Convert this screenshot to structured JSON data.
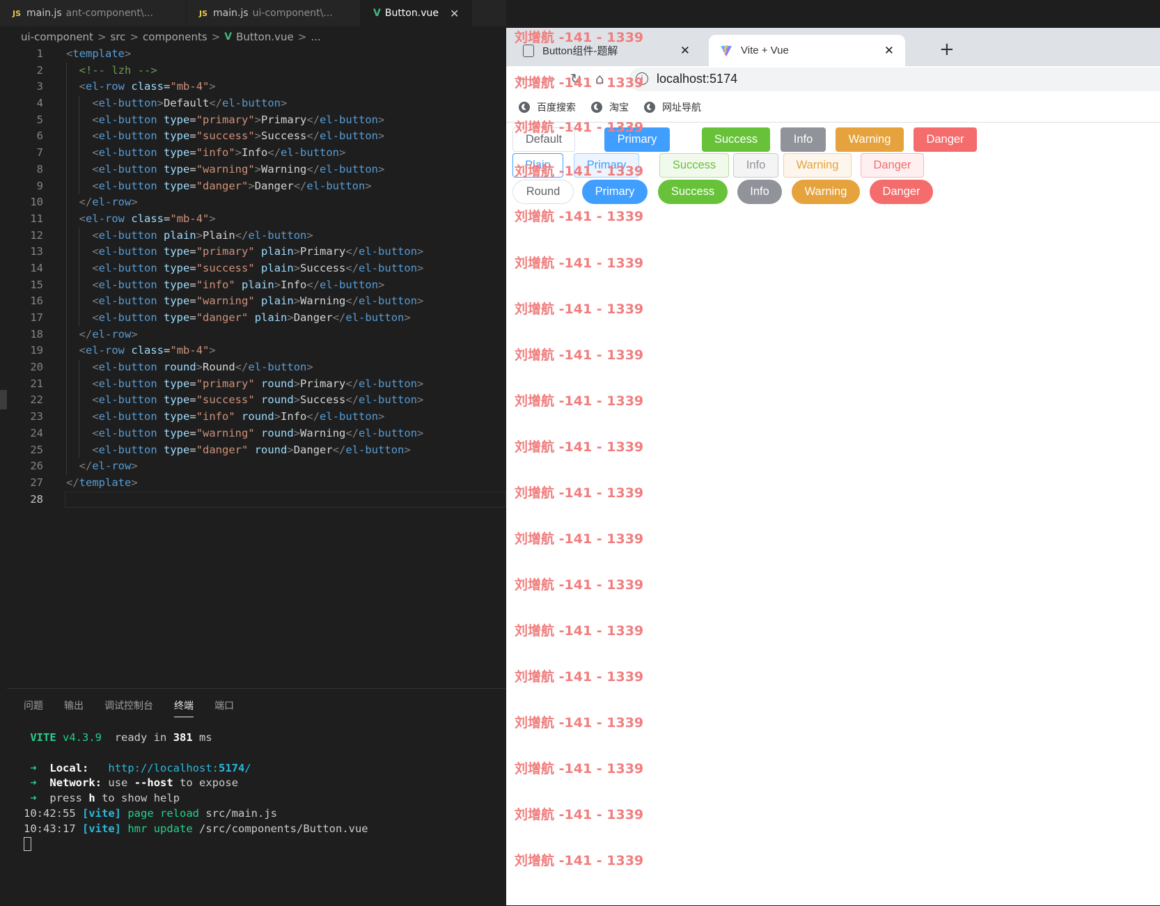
{
  "editor": {
    "tabs": [
      {
        "icon": "JS",
        "name": "main.js",
        "dir": "ant-component\\..."
      },
      {
        "icon": "JS",
        "name": "main.js",
        "dir": "ui-component\\..."
      },
      {
        "icon": "V",
        "name": "Button.vue",
        "close": "✕"
      }
    ],
    "breadcrumb": [
      "ui-component",
      "src",
      "components",
      "Button.vue",
      "..."
    ],
    "breadcrumb_sep": ">",
    "line_numbers": [
      "1",
      "2",
      "3",
      "4",
      "5",
      "6",
      "7",
      "8",
      "9",
      "10",
      "11",
      "12",
      "13",
      "14",
      "15",
      "16",
      "17",
      "18",
      "19",
      "20",
      "21",
      "22",
      "23",
      "24",
      "25",
      "26",
      "27",
      "28"
    ],
    "code_lines": [
      [
        [
          "br",
          "<"
        ],
        [
          "tag",
          "template"
        ],
        [
          "br",
          ">"
        ]
      ],
      [
        [
          "tx",
          "  "
        ],
        [
          "cm",
          "<!-- lzh -->"
        ]
      ],
      [
        [
          "tx",
          "  "
        ],
        [
          "br",
          "<"
        ],
        [
          "tag",
          "el-row"
        ],
        [
          "tx",
          " "
        ],
        [
          "at",
          "class"
        ],
        [
          "tx",
          "="
        ],
        [
          "st",
          "\"mb-4\""
        ],
        [
          "br",
          ">"
        ]
      ],
      [
        [
          "tx",
          "    "
        ],
        [
          "br",
          "<"
        ],
        [
          "tag",
          "el-button"
        ],
        [
          "br",
          ">"
        ],
        [
          "tx",
          "Default"
        ],
        [
          "br",
          "</"
        ],
        [
          "tag",
          "el-button"
        ],
        [
          "br",
          ">"
        ]
      ],
      [
        [
          "tx",
          "    "
        ],
        [
          "br",
          "<"
        ],
        [
          "tag",
          "el-button"
        ],
        [
          "tx",
          " "
        ],
        [
          "at",
          "type"
        ],
        [
          "tx",
          "="
        ],
        [
          "st",
          "\"primary\""
        ],
        [
          "br",
          ">"
        ],
        [
          "tx",
          "Primary"
        ],
        [
          "br",
          "</"
        ],
        [
          "tag",
          "el-button"
        ],
        [
          "br",
          ">"
        ]
      ],
      [
        [
          "tx",
          "    "
        ],
        [
          "br",
          "<"
        ],
        [
          "tag",
          "el-button"
        ],
        [
          "tx",
          " "
        ],
        [
          "at",
          "type"
        ],
        [
          "tx",
          "="
        ],
        [
          "st",
          "\"success\""
        ],
        [
          "br",
          ">"
        ],
        [
          "tx",
          "Success"
        ],
        [
          "br",
          "</"
        ],
        [
          "tag",
          "el-button"
        ],
        [
          "br",
          ">"
        ]
      ],
      [
        [
          "tx",
          "    "
        ],
        [
          "br",
          "<"
        ],
        [
          "tag",
          "el-button"
        ],
        [
          "tx",
          " "
        ],
        [
          "at",
          "type"
        ],
        [
          "tx",
          "="
        ],
        [
          "st",
          "\"info\""
        ],
        [
          "br",
          ">"
        ],
        [
          "tx",
          "Info"
        ],
        [
          "br",
          "</"
        ],
        [
          "tag",
          "el-button"
        ],
        [
          "br",
          ">"
        ]
      ],
      [
        [
          "tx",
          "    "
        ],
        [
          "br",
          "<"
        ],
        [
          "tag",
          "el-button"
        ],
        [
          "tx",
          " "
        ],
        [
          "at",
          "type"
        ],
        [
          "tx",
          "="
        ],
        [
          "st",
          "\"warning\""
        ],
        [
          "br",
          ">"
        ],
        [
          "tx",
          "Warning"
        ],
        [
          "br",
          "</"
        ],
        [
          "tag",
          "el-button"
        ],
        [
          "br",
          ">"
        ]
      ],
      [
        [
          "tx",
          "    "
        ],
        [
          "br",
          "<"
        ],
        [
          "tag",
          "el-button"
        ],
        [
          "tx",
          " "
        ],
        [
          "at",
          "type"
        ],
        [
          "tx",
          "="
        ],
        [
          "st",
          "\"danger\""
        ],
        [
          "br",
          ">"
        ],
        [
          "tx",
          "Danger"
        ],
        [
          "br",
          "</"
        ],
        [
          "tag",
          "el-button"
        ],
        [
          "br",
          ">"
        ]
      ],
      [
        [
          "tx",
          "  "
        ],
        [
          "br",
          "</"
        ],
        [
          "tag",
          "el-row"
        ],
        [
          "br",
          ">"
        ]
      ],
      [
        [
          "tx",
          "  "
        ],
        [
          "br",
          "<"
        ],
        [
          "tag",
          "el-row"
        ],
        [
          "tx",
          " "
        ],
        [
          "at",
          "class"
        ],
        [
          "tx",
          "="
        ],
        [
          "st",
          "\"mb-4\""
        ],
        [
          "br",
          ">"
        ]
      ],
      [
        [
          "tx",
          "    "
        ],
        [
          "br",
          "<"
        ],
        [
          "tag",
          "el-button"
        ],
        [
          "tx",
          " "
        ],
        [
          "at",
          "plain"
        ],
        [
          "br",
          ">"
        ],
        [
          "tx",
          "Plain"
        ],
        [
          "br",
          "</"
        ],
        [
          "tag",
          "el-button"
        ],
        [
          "br",
          ">"
        ]
      ],
      [
        [
          "tx",
          "    "
        ],
        [
          "br",
          "<"
        ],
        [
          "tag",
          "el-button"
        ],
        [
          "tx",
          " "
        ],
        [
          "at",
          "type"
        ],
        [
          "tx",
          "="
        ],
        [
          "st",
          "\"primary\""
        ],
        [
          "tx",
          " "
        ],
        [
          "at",
          "plain"
        ],
        [
          "br",
          ">"
        ],
        [
          "tx",
          "Primary"
        ],
        [
          "br",
          "</"
        ],
        [
          "tag",
          "el-button"
        ],
        [
          "br",
          ">"
        ]
      ],
      [
        [
          "tx",
          "    "
        ],
        [
          "br",
          "<"
        ],
        [
          "tag",
          "el-button"
        ],
        [
          "tx",
          " "
        ],
        [
          "at",
          "type"
        ],
        [
          "tx",
          "="
        ],
        [
          "st",
          "\"success\""
        ],
        [
          "tx",
          " "
        ],
        [
          "at",
          "plain"
        ],
        [
          "br",
          ">"
        ],
        [
          "tx",
          "Success"
        ],
        [
          "br",
          "</"
        ],
        [
          "tag",
          "el-button"
        ],
        [
          "br",
          ">"
        ]
      ],
      [
        [
          "tx",
          "    "
        ],
        [
          "br",
          "<"
        ],
        [
          "tag",
          "el-button"
        ],
        [
          "tx",
          " "
        ],
        [
          "at",
          "type"
        ],
        [
          "tx",
          "="
        ],
        [
          "st",
          "\"info\""
        ],
        [
          "tx",
          " "
        ],
        [
          "at",
          "plain"
        ],
        [
          "br",
          ">"
        ],
        [
          "tx",
          "Info"
        ],
        [
          "br",
          "</"
        ],
        [
          "tag",
          "el-button"
        ],
        [
          "br",
          ">"
        ]
      ],
      [
        [
          "tx",
          "    "
        ],
        [
          "br",
          "<"
        ],
        [
          "tag",
          "el-button"
        ],
        [
          "tx",
          " "
        ],
        [
          "at",
          "type"
        ],
        [
          "tx",
          "="
        ],
        [
          "st",
          "\"warning\""
        ],
        [
          "tx",
          " "
        ],
        [
          "at",
          "plain"
        ],
        [
          "br",
          ">"
        ],
        [
          "tx",
          "Warning"
        ],
        [
          "br",
          "</"
        ],
        [
          "tag",
          "el-button"
        ],
        [
          "br",
          ">"
        ]
      ],
      [
        [
          "tx",
          "    "
        ],
        [
          "br",
          "<"
        ],
        [
          "tag",
          "el-button"
        ],
        [
          "tx",
          " "
        ],
        [
          "at",
          "type"
        ],
        [
          "tx",
          "="
        ],
        [
          "st",
          "\"danger\""
        ],
        [
          "tx",
          " "
        ],
        [
          "at",
          "plain"
        ],
        [
          "br",
          ">"
        ],
        [
          "tx",
          "Danger"
        ],
        [
          "br",
          "</"
        ],
        [
          "tag",
          "el-button"
        ],
        [
          "br",
          ">"
        ]
      ],
      [
        [
          "tx",
          "  "
        ],
        [
          "br",
          "</"
        ],
        [
          "tag",
          "el-row"
        ],
        [
          "br",
          ">"
        ]
      ],
      [
        [
          "tx",
          "  "
        ],
        [
          "br",
          "<"
        ],
        [
          "tag",
          "el-row"
        ],
        [
          "tx",
          " "
        ],
        [
          "at",
          "class"
        ],
        [
          "tx",
          "="
        ],
        [
          "st",
          "\"mb-4\""
        ],
        [
          "br",
          ">"
        ]
      ],
      [
        [
          "tx",
          "    "
        ],
        [
          "br",
          "<"
        ],
        [
          "tag",
          "el-button"
        ],
        [
          "tx",
          " "
        ],
        [
          "at",
          "round"
        ],
        [
          "br",
          ">"
        ],
        [
          "tx",
          "Round"
        ],
        [
          "br",
          "</"
        ],
        [
          "tag",
          "el-button"
        ],
        [
          "br",
          ">"
        ]
      ],
      [
        [
          "tx",
          "    "
        ],
        [
          "br",
          "<"
        ],
        [
          "tag",
          "el-button"
        ],
        [
          "tx",
          " "
        ],
        [
          "at",
          "type"
        ],
        [
          "tx",
          "="
        ],
        [
          "st",
          "\"primary\""
        ],
        [
          "tx",
          " "
        ],
        [
          "at",
          "round"
        ],
        [
          "br",
          ">"
        ],
        [
          "tx",
          "Primary"
        ],
        [
          "br",
          "</"
        ],
        [
          "tag",
          "el-button"
        ],
        [
          "br",
          ">"
        ]
      ],
      [
        [
          "tx",
          "    "
        ],
        [
          "br",
          "<"
        ],
        [
          "tag",
          "el-button"
        ],
        [
          "tx",
          " "
        ],
        [
          "at",
          "type"
        ],
        [
          "tx",
          "="
        ],
        [
          "st",
          "\"success\""
        ],
        [
          "tx",
          " "
        ],
        [
          "at",
          "round"
        ],
        [
          "br",
          ">"
        ],
        [
          "tx",
          "Success"
        ],
        [
          "br",
          "</"
        ],
        [
          "tag",
          "el-button"
        ],
        [
          "br",
          ">"
        ]
      ],
      [
        [
          "tx",
          "    "
        ],
        [
          "br",
          "<"
        ],
        [
          "tag",
          "el-button"
        ],
        [
          "tx",
          " "
        ],
        [
          "at",
          "type"
        ],
        [
          "tx",
          "="
        ],
        [
          "st",
          "\"info\""
        ],
        [
          "tx",
          " "
        ],
        [
          "at",
          "round"
        ],
        [
          "br",
          ">"
        ],
        [
          "tx",
          "Info"
        ],
        [
          "br",
          "</"
        ],
        [
          "tag",
          "el-button"
        ],
        [
          "br",
          ">"
        ]
      ],
      [
        [
          "tx",
          "    "
        ],
        [
          "br",
          "<"
        ],
        [
          "tag",
          "el-button"
        ],
        [
          "tx",
          " "
        ],
        [
          "at",
          "type"
        ],
        [
          "tx",
          "="
        ],
        [
          "st",
          "\"warning\""
        ],
        [
          "tx",
          " "
        ],
        [
          "at",
          "round"
        ],
        [
          "br",
          ">"
        ],
        [
          "tx",
          "Warning"
        ],
        [
          "br",
          "</"
        ],
        [
          "tag",
          "el-button"
        ],
        [
          "br",
          ">"
        ]
      ],
      [
        [
          "tx",
          "    "
        ],
        [
          "br",
          "<"
        ],
        [
          "tag",
          "el-button"
        ],
        [
          "tx",
          " "
        ],
        [
          "at",
          "type"
        ],
        [
          "tx",
          "="
        ],
        [
          "st",
          "\"danger\""
        ],
        [
          "tx",
          " "
        ],
        [
          "at",
          "round"
        ],
        [
          "br",
          ">"
        ],
        [
          "tx",
          "Danger"
        ],
        [
          "br",
          "</"
        ],
        [
          "tag",
          "el-button"
        ],
        [
          "br",
          ">"
        ]
      ],
      [
        [
          "tx",
          "  "
        ],
        [
          "br",
          "</"
        ],
        [
          "tag",
          "el-row"
        ],
        [
          "br",
          ">"
        ]
      ],
      [
        [
          "br",
          "</"
        ],
        [
          "tag",
          "template"
        ],
        [
          "br",
          ">"
        ]
      ],
      []
    ]
  },
  "panel": {
    "tabs": [
      "问题",
      "输出",
      "调试控制台",
      "终端",
      "端口"
    ],
    "active_tab": "终端",
    "terminal": {
      "vite_name": "VITE",
      "vite_version": "v4.3.9",
      "ready_prefix": "ready in",
      "ready_ms": "381",
      "ready_unit": "ms",
      "arrow": "➜",
      "local_label": "Local:",
      "local_url_prefix": "http://localhost:",
      "local_port": "5174",
      "local_url_suffix": "/",
      "network_label": "Network:",
      "network_pre": "use",
      "network_flag": "--host",
      "network_post": "to expose",
      "press_pre": "press",
      "press_key": "h",
      "press_post": "to show help",
      "logs": [
        {
          "time": "10:42:55",
          "tag": "[vite]",
          "action": "page reload",
          "path": "src/main.js"
        },
        {
          "time": "10:43:17",
          "tag": "[vite]",
          "action": "hmr update",
          "path": "/src/components/Button.vue"
        }
      ]
    }
  },
  "browser": {
    "tabs": [
      {
        "title": "Button组件-题解",
        "close": "✕"
      },
      {
        "title": "Vite + Vue",
        "close": "✕"
      }
    ],
    "new_tab": "+",
    "url": "localhost:5174",
    "bookmarks": [
      "百度搜索",
      "淘宝",
      "网址导航"
    ],
    "rows": [
      [
        {
          "label": "Default",
          "variant": "default"
        },
        {
          "label": "Primary",
          "variant": "primary"
        },
        {
          "label": "Success",
          "variant": "success"
        },
        {
          "label": "Info",
          "variant": "info"
        },
        {
          "label": "Warning",
          "variant": "warning"
        },
        {
          "label": "Danger",
          "variant": "danger"
        }
      ],
      [
        {
          "label": "Plain",
          "variant": "default-plain"
        },
        {
          "label": "Primary",
          "variant": "primary-plain"
        },
        {
          "label": "Success",
          "variant": "success-plain"
        },
        {
          "label": "Info",
          "variant": "info-plain"
        },
        {
          "label": "Warning",
          "variant": "warning-plain"
        },
        {
          "label": "Danger",
          "variant": "danger-plain"
        }
      ],
      [
        {
          "label": "Round",
          "variant": "default-round"
        },
        {
          "label": "Primary",
          "variant": "primary-round"
        },
        {
          "label": "Success",
          "variant": "success-round"
        },
        {
          "label": "Info",
          "variant": "info-round"
        },
        {
          "label": "Warning",
          "variant": "warning-round"
        },
        {
          "label": "Danger",
          "variant": "danger-round"
        }
      ]
    ],
    "watermark": "刘增航 -141 - 1339",
    "colors": {
      "primary": "#409eff",
      "success": "#67c23a",
      "info": "#909399",
      "warning": "#e6a23c",
      "danger": "#f56c6c",
      "default_border": "#dcdfe6",
      "default_text": "#606266",
      "primary_plain_bg": "#ecf5ff",
      "primary_plain_border": "#a0cfff",
      "success_plain_bg": "#f0f9eb",
      "success_plain_border": "#b3e19d",
      "info_plain_bg": "#f4f4f5",
      "info_plain_border": "#c8c9cc",
      "warning_plain_bg": "#fdf6ec",
      "warning_plain_border": "#f3d19e",
      "danger_plain_bg": "#fef0f0",
      "danger_plain_border": "#fab6b6"
    }
  }
}
